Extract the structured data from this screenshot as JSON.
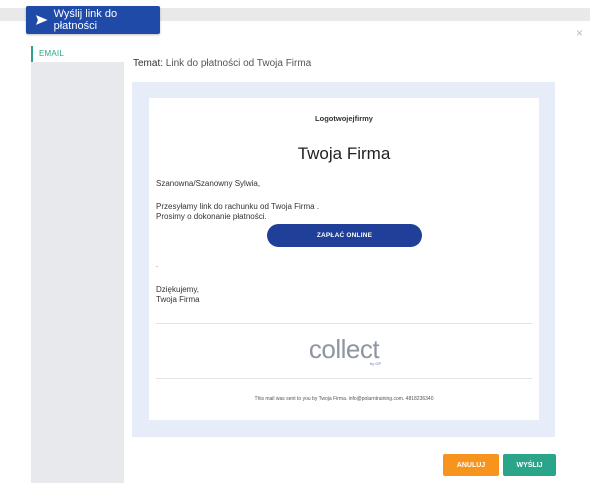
{
  "header": {
    "send_button_label": "Wyślij link do płatności",
    "send_icon": "send-arrow-icon",
    "close_icon": "close-icon"
  },
  "sidebar": {
    "tabs": [
      {
        "label": "EMAIL"
      }
    ]
  },
  "email": {
    "subject_label": "Temat:",
    "subject_value": "Link do płatności od Twoja Firma",
    "logo_text": "Logotwojejfirmy",
    "company_name": "Twoja Firma",
    "greeting": "Szanowna/Szanowny Sylwia,",
    "body_line1": "Przesyłamy link do rachunku od Twoja Firma .",
    "body_line2": "Prosimy o dokonanie płatności.",
    "pay_button": "ZAPŁAĆ ONLINE",
    "dot": ".",
    "thanks": "Dziękujemy,",
    "signature": "Twoja Firma",
    "brand_logo": "collect",
    "brand_sub": "by GP",
    "footer": "This mail was sent to you by Twoja Firma. info@polarntraining.com. 4818236340"
  },
  "actions": {
    "cancel_label": "ANULUJ",
    "send_label": "WYŚLIJ"
  },
  "colors": {
    "primary": "#1f4aa8",
    "accent_green": "#2aa58a",
    "cancel_orange": "#f7941d",
    "preview_bg": "#e6edf9"
  }
}
